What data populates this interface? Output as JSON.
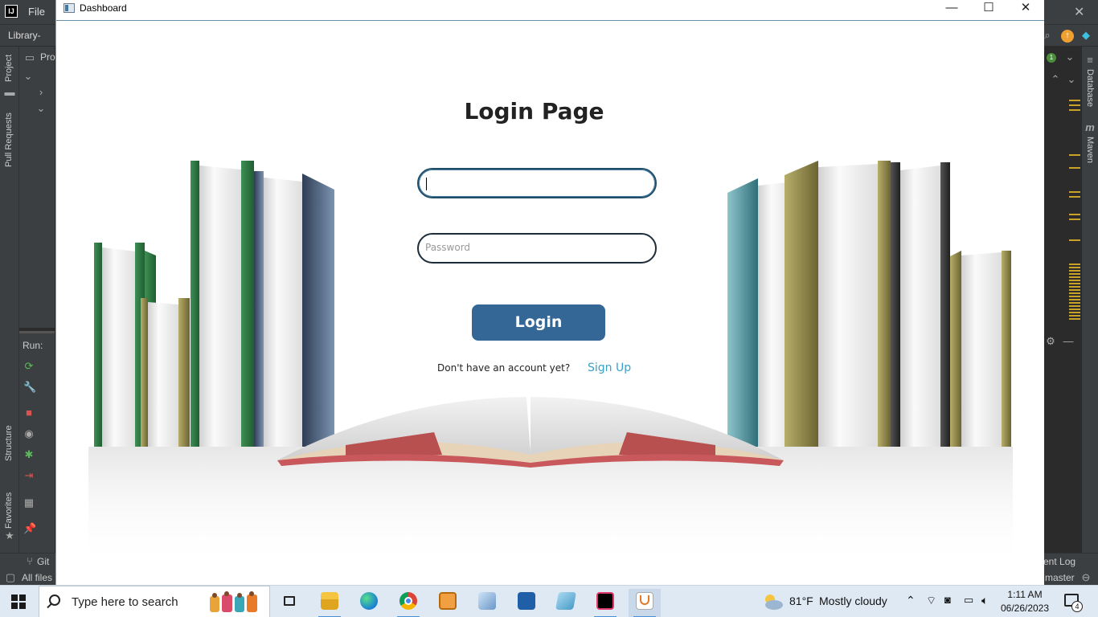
{
  "ide": {
    "menu_file": "File",
    "breadcrumb": "Library-",
    "project_tab": "Pro",
    "left_tabs": [
      "Project",
      "Pull Requests",
      "Structure",
      "Favorites"
    ],
    "right_tabs": [
      "Database",
      "Maven"
    ],
    "run_label": "Run:",
    "status_git": "Git",
    "status_all_files": "All files",
    "status_event_log": "ent Log",
    "status_branch": "master"
  },
  "window": {
    "title": "Dashboard",
    "minimize": "—",
    "maximize": "☐",
    "close": "✕"
  },
  "login": {
    "heading": "Login Page",
    "username_value": "",
    "password_placeholder": "Password",
    "login_button": "Login",
    "signup_prompt": "Don't have an account yet?",
    "signup_link": "Sign Up"
  },
  "taskbar": {
    "search_placeholder": "Type here to search",
    "apps": [
      "task-view-icon",
      "file-explorer-icon",
      "edge-icon",
      "chrome-icon",
      "media-player-icon",
      "photos-icon",
      "movies-icon",
      "notepad-icon",
      "intellij-icon",
      "java-icon"
    ],
    "weather_temp": "81°F",
    "weather_desc": "Mostly cloudy",
    "time": "1:11 AM",
    "date": "06/26/2023",
    "notification_count": "4"
  },
  "colors": {
    "login_button": "#356796",
    "signup_link": "#3aa0c8",
    "ide_bg": "#2b2b2b",
    "taskbar_bg": "#dfe9f4"
  }
}
